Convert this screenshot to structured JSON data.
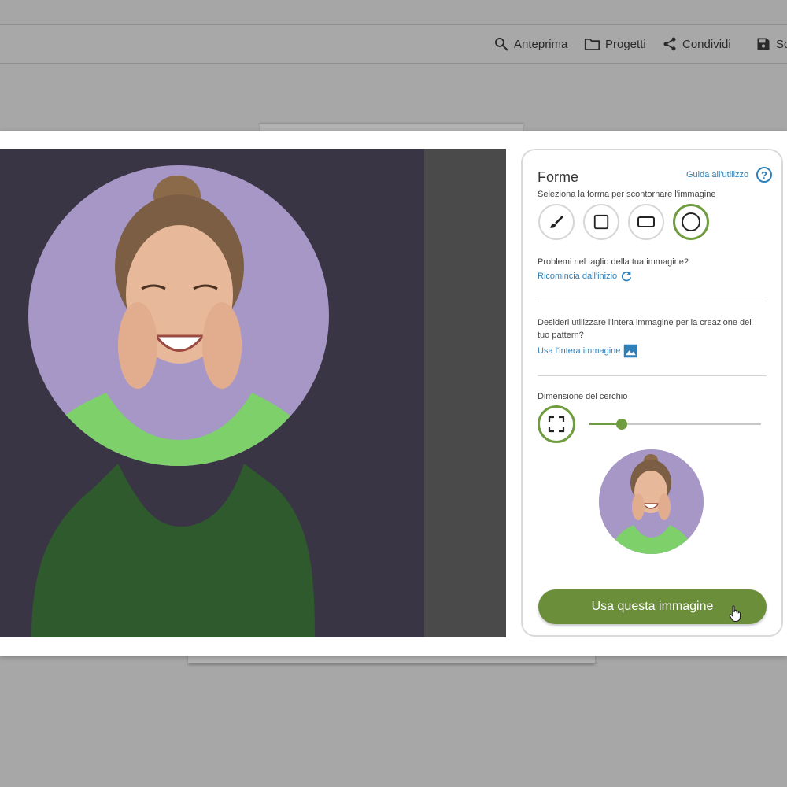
{
  "toolbar": {
    "preview_label": "Anteprima",
    "projects_label": "Progetti",
    "share_label": "Condividi",
    "save_label": "Sc"
  },
  "panel": {
    "title": "Forme",
    "help_link": "Guida all'utilizzo",
    "help_icon": "?",
    "shape_prompt": "Seleziona la forma per scontornare l'immagine",
    "shapes": [
      {
        "icon": "brush-icon",
        "selected": false
      },
      {
        "icon": "square-icon",
        "selected": false
      },
      {
        "icon": "rectangle-icon",
        "selected": false
      },
      {
        "icon": "circle-icon",
        "selected": true
      }
    ],
    "problem_text": "Problemi nel taglio della tua immagine?",
    "restart_link": "Ricomincia dall'inizio",
    "whole_image_question": "Desideri utilizzare l'intera immagine per la creazione del tuo pattern?",
    "whole_image_link": "Usa l'intera immagine",
    "circle_size_label": "Dimensione del cerchio",
    "circle_size_value": 0.19,
    "use_button": "Usa questa immagine"
  },
  "colors": {
    "accent": "#6f9c3f",
    "button": "#6b8e3a",
    "link": "#2f7fb8"
  }
}
